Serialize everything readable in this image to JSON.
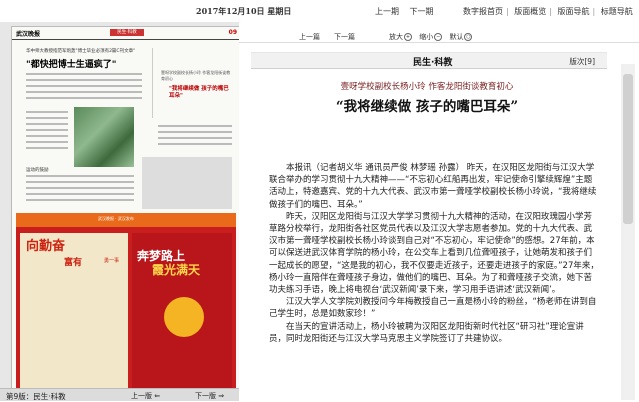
{
  "topbar": {
    "date": "2017年12月10日 星期日",
    "prev_page": "上一期",
    "next_page": "下一期",
    "links": [
      "数字报首页",
      "版面概览",
      "版面导航",
      "标题导航"
    ]
  },
  "newspaper": {
    "masthead": "武汉晚报",
    "badge": "民生·科教",
    "page": "09",
    "kicker": "华中师大教授指范军炮轰\"博士毕业必须有2篇C刊文章\"",
    "headline": "\"都快把博士生逼疯了\"",
    "side_sub": "壹呀学校副校长杨小玲 作客龙阳街谈教育初心",
    "side_title": "\"我将继续做 孩子的嘴巴耳朵\"",
    "photo_caption": "运动的鼓励",
    "band_text": "武汉晚报 · 武汉发布",
    "poster1_title": "向勤奋",
    "poster1_title2": "富有",
    "poster1_sub": "勇一事",
    "poster2_title1": "奔梦路上",
    "poster2_title2": "霞光满天"
  },
  "bottomnav": {
    "page_label": "第9版：民生·科教",
    "prev": "上一版 ⇐",
    "next": "下一版 ⇒"
  },
  "toolbar": {
    "prev": "上一篇",
    "next": "下一篇",
    "zoom_label": "放大",
    "zoom_out_label": "缩小",
    "default_label": "默认"
  },
  "article": {
    "section": "民生·科教",
    "page_num": "版次[9]",
    "subhead": "壹呀学校副校长杨小玲 作客龙阳街谈教育初心",
    "headline": "“我将继续做 孩子的嘴巴耳朵”",
    "paragraphs": [
      "本报讯（记者胡义华 通讯员严俊 林梦瑶 孙露） 昨天，在汉阳区龙阳街与江汉大学联合举办的学习贯彻十九大精神——“不忘初心红船再出发，牢记使命引擎续辉煌”主题活动上，特邀嘉宾、党的十九大代表、武汉市第一聋哑学校副校长杨小玲说，“我将继续做孩子们的嘴巴、耳朵。”",
      "昨天，汉阳区龙阳街与江汉大学学习贯彻十九大精神的活动，在汉阳玫瑰园小学芳草路分校举行，龙阳街各社区党员代表以及江汉大学志愿者参加。党的十九大代表、武汉市第一聋哑学校副校长杨小玲谈到自己对“不忘初心，牢记使命”的感想。27年前，本可以保送进武汉体育学院的杨小玲，在公交车上看到几位聋哑孩子，让她萌发和孩子们一起成长的愿望，“这是我的初心，我不仅要走近孩子，还要走进孩子的家庭。”27年来，杨小玲一直陪伴在聋哑孩子身边，做他们的嘴巴、耳朵。为了和聋哑孩子交流，她下苦功夫练习手语，晚上将电视台‘武汉新闻’录下来，学习用手语讲述‘武汉新闻’。",
      "江汉大学人文学院刘教授问今年梅教授自己一直是杨小玲的粉丝，“杨老师在讲到自己学生时，总是如数家珍！”",
      "在当天的宣讲活动上，杨小玲被聘为汉阳区龙阳街新时代社区“研习社”理论宣讲员，同时龙阳街还与江汉大学马克思主义学院签订了共建协议。"
    ]
  },
  "colors": {
    "accent_red": "#c91e1e",
    "headline_color": "#7a2222"
  }
}
